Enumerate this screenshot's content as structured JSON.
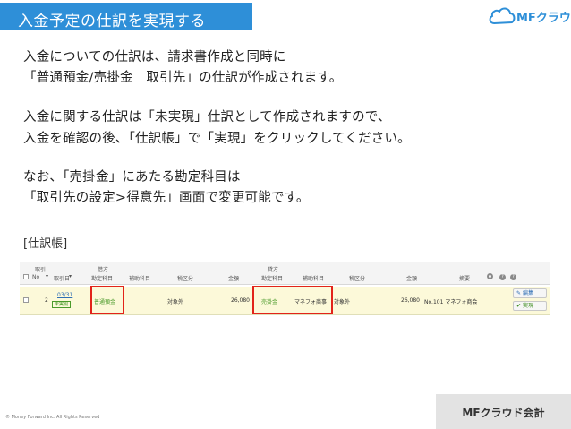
{
  "header": {
    "title": "入金予定の仕訳を実現する",
    "logo_text": "MFクラウド",
    "logo_icon": "cloud-icon",
    "title_bg": "#2e8fd8"
  },
  "body": {
    "line1": "入金についての仕訳は、請求書作成と同時に",
    "line2": "「普通預金/売掛金　取引先」の仕訳が作成されます。",
    "line3": "入金に関する仕訳は「未実現」仕訳として作成されますので、",
    "line4": "入金を確認の後、「仕訳帳」で「実現」をクリックしてください。",
    "line5": "なお、「売掛金」にあたる勘定科目は",
    "line6": "「取引先の設定>得意先」画面で変更可能です。"
  },
  "journal": {
    "label": "[仕訳帳]",
    "headers": {
      "no_top": "取引",
      "no": "No",
      "date": "取引日",
      "debit_group": "借方",
      "debit_account": "勘定科目",
      "debit_sub": "補助科目",
      "debit_tax": "税区分",
      "debit_amount": "金額",
      "credit_group": "貸方",
      "credit_account": "勘定科目",
      "credit_sub": "補助科目",
      "credit_tax": "税区分",
      "credit_amount": "金額",
      "memo": "摘要"
    },
    "row": {
      "no": "2",
      "date": "03/31",
      "status": "未実現",
      "debit_account": "普通預金",
      "debit_tax": "対象外",
      "debit_amount": "26,080",
      "credit_account": "売掛金",
      "credit_sub": "マネフォ商事",
      "credit_tax": "対象外",
      "credit_amount": "26,080",
      "memo": "No.101 マネフォ商会",
      "edit_label": "編集",
      "realize_label": "実現"
    },
    "highlight_color": "#e2231a"
  },
  "footer": {
    "copyright": "© Money Forward Inc. All Rights Reserved",
    "brand": "MFクラウド会計"
  }
}
